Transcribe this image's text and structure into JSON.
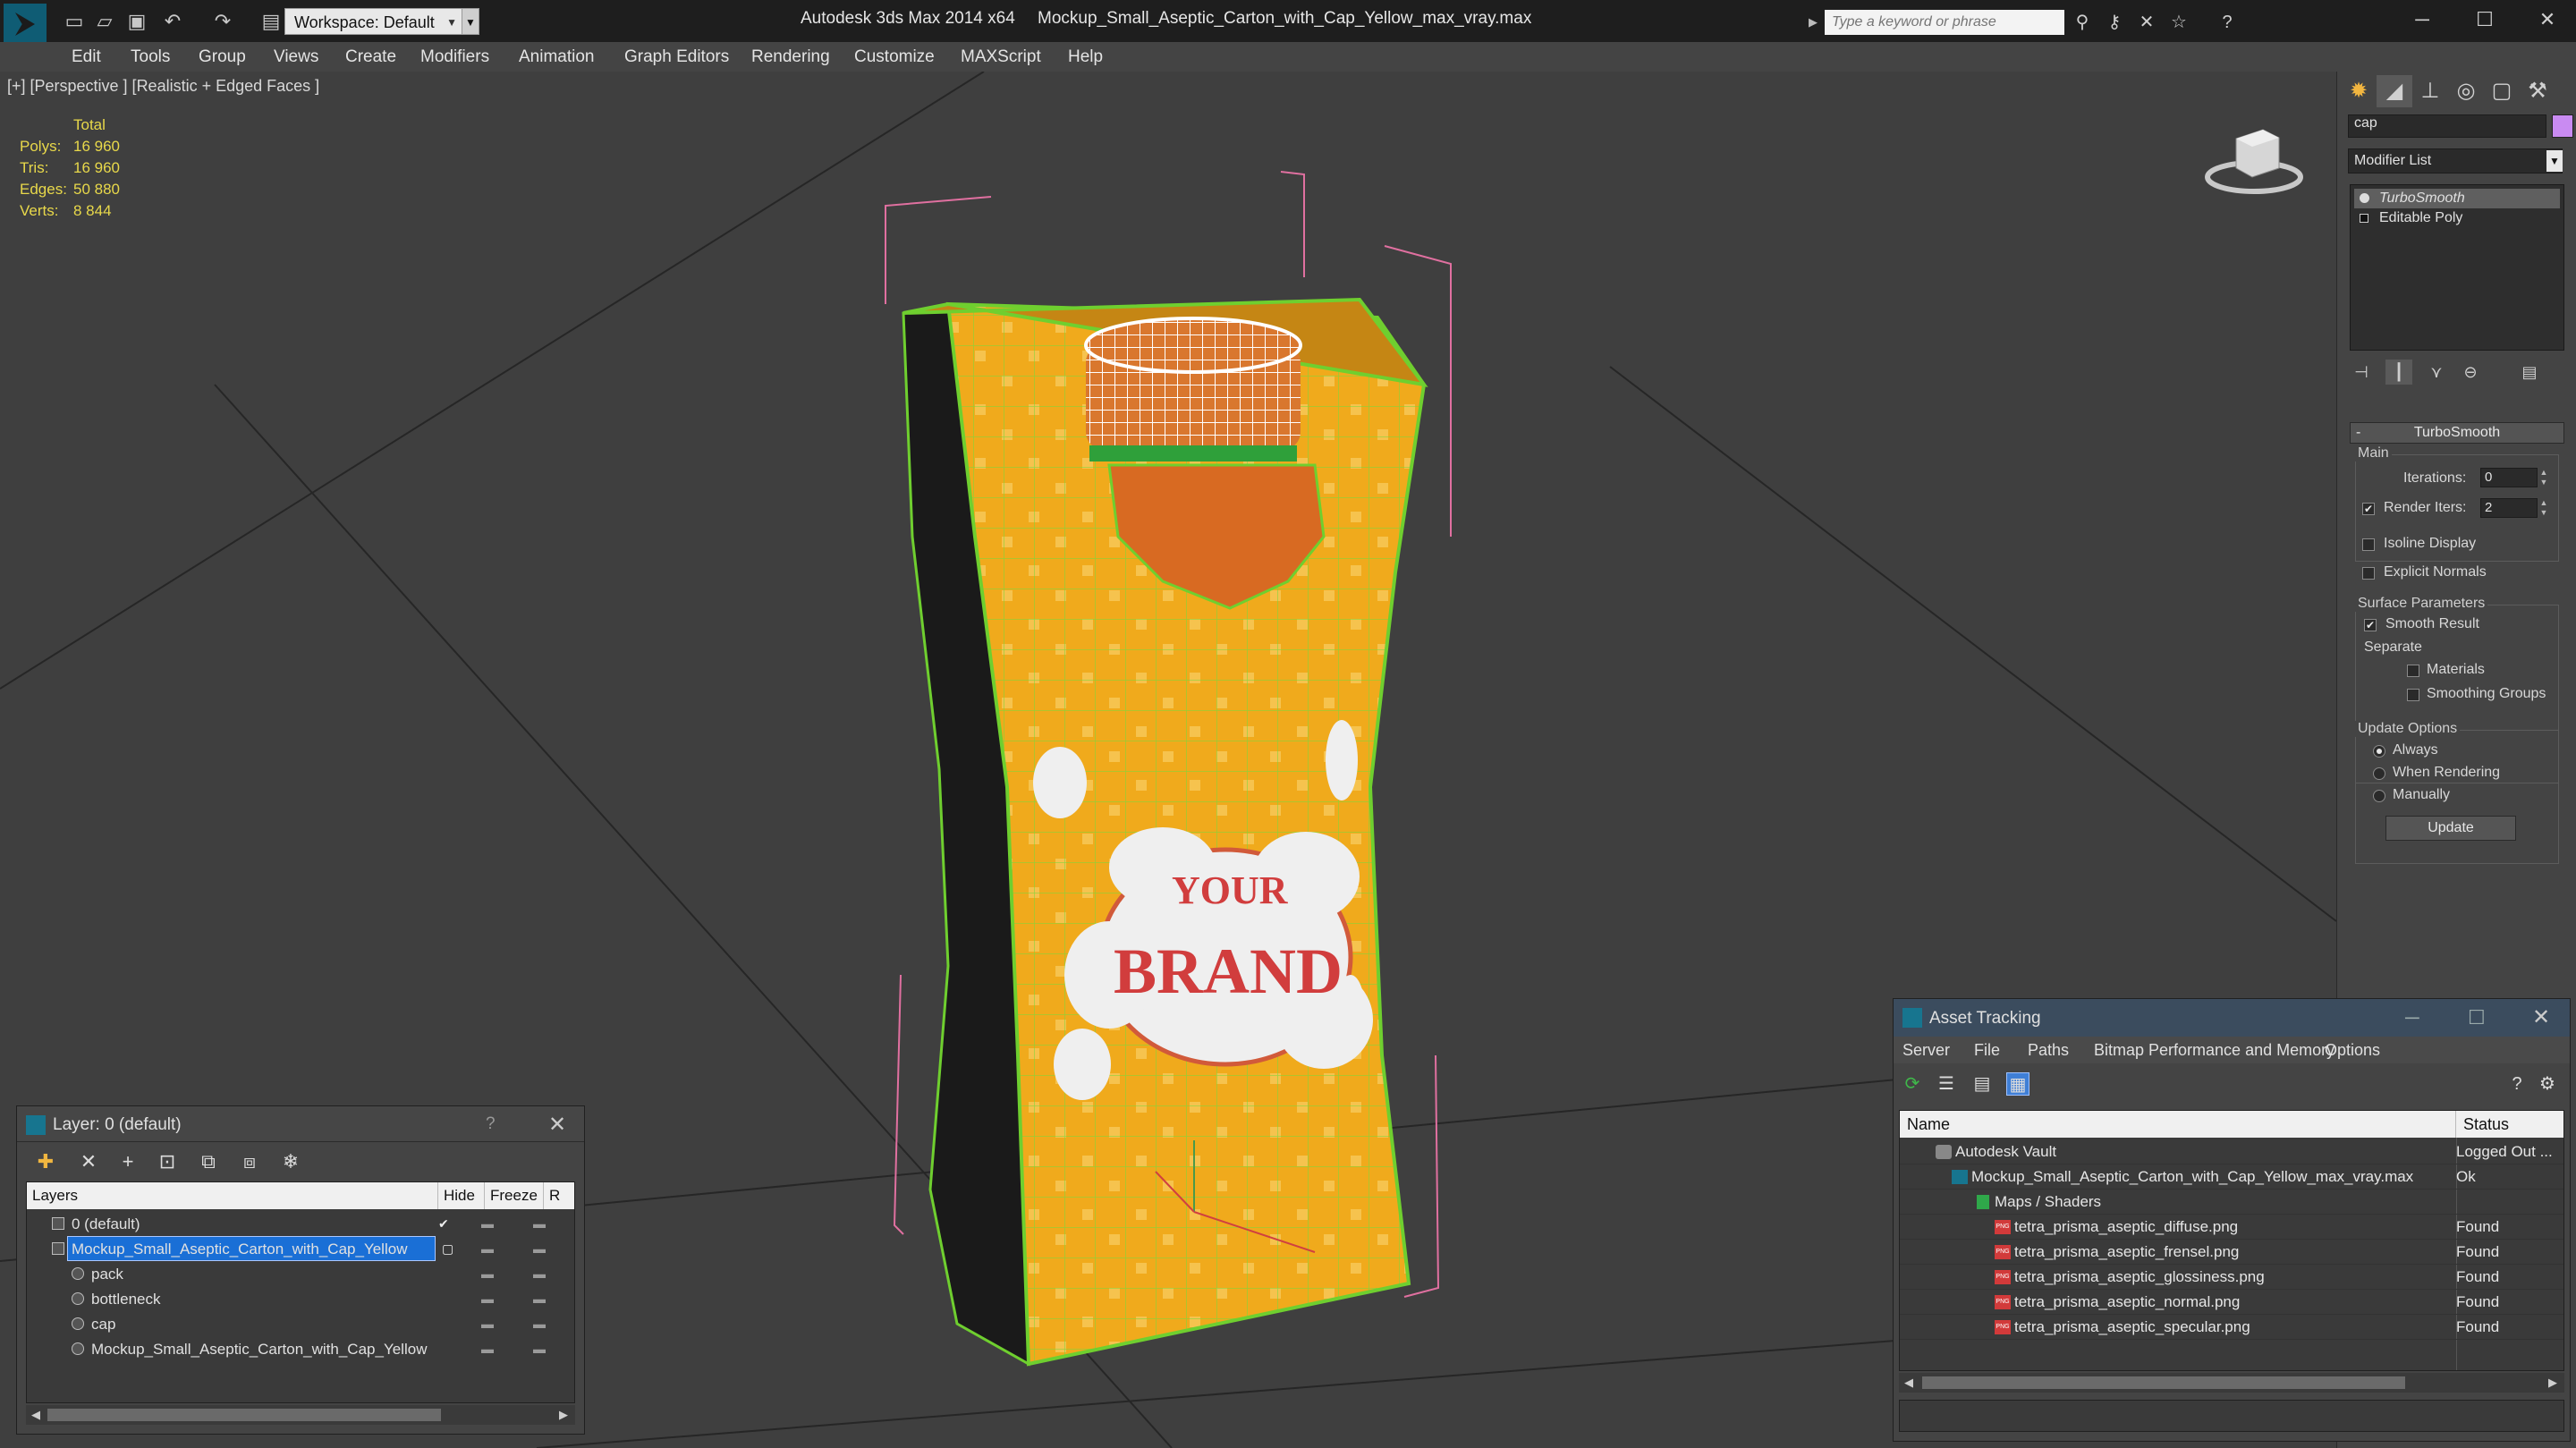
{
  "app": {
    "title": "Autodesk 3ds Max  2014 x64",
    "file": "Mockup_Small_Aseptic_Carton_with_Cap_Yellow_max_vray.max",
    "workspace": "Workspace: Default",
    "search_placeholder": "Type a keyword or phrase"
  },
  "menu": [
    "Edit",
    "Tools",
    "Group",
    "Views",
    "Create",
    "Modifiers",
    "Animation",
    "Graph Editors",
    "Rendering",
    "Customize",
    "MAXScript",
    "Help"
  ],
  "viewport": {
    "label": "[+] [Perspective ] [Realistic + Edged Faces ]",
    "stats": {
      "header": "Total",
      "rows": [
        {
          "key": "Polys:",
          "value": "16 960"
        },
        {
          "key": "Tris:",
          "value": "16 960"
        },
        {
          "key": "Edges:",
          "value": "50 880"
        },
        {
          "key": "Verts:",
          "value": "8 844"
        }
      ]
    },
    "label_text_top": "YOUR",
    "label_text_bottom": "BRAND"
  },
  "command_panel": {
    "object_name": "cap",
    "object_color": "#c98bf2",
    "modifier_list": "Modifier List",
    "stack": [
      "TurboSmooth",
      "Editable Poly"
    ],
    "rollout": "TurboSmooth",
    "main_group": "Main",
    "iterations_label": "Iterations:",
    "iterations": "0",
    "render_iters_label": "Render Iters:",
    "render_iters": "2",
    "isoline": "Isoline Display",
    "explicit_normals": "Explicit Normals",
    "surface_group": "Surface Parameters",
    "smooth_result": "Smooth Result",
    "separate": "Separate",
    "materials": "Materials",
    "smoothing_groups": "Smoothing Groups",
    "update_group": "Update Options",
    "always": "Always",
    "when_rendering": "When Rendering",
    "manually": "Manually",
    "update_button": "Update"
  },
  "layer_window": {
    "title": "Layer: 0 (default)",
    "help": "?",
    "columns": [
      "Layers",
      "Hide",
      "Freeze",
      "R"
    ],
    "rows": [
      {
        "name": "0 (default)",
        "indent": 1
      },
      {
        "name": "Mockup_Small_Aseptic_Carton_with_Cap_Yellow",
        "indent": 1
      },
      {
        "name": "pack",
        "indent": 2
      },
      {
        "name": "bottleneck",
        "indent": 2
      },
      {
        "name": "cap",
        "indent": 2
      },
      {
        "name": "Mockup_Small_Aseptic_Carton_with_Cap_Yellow",
        "indent": 2
      }
    ]
  },
  "asset_window": {
    "title": "Asset Tracking",
    "menu": [
      "Server",
      "File",
      "Paths",
      "Bitmap Performance and Memory",
      "Options"
    ],
    "columns": [
      "Name",
      "Status"
    ],
    "rows": [
      {
        "name": "Autodesk Vault",
        "status": "Logged Out ...",
        "icon": "vault",
        "indent": 1
      },
      {
        "name": "Mockup_Small_Aseptic_Carton_with_Cap_Yellow_max_vray.max",
        "status": "Ok",
        "icon": "max",
        "indent": 2
      },
      {
        "name": "Maps / Shaders",
        "status": "",
        "icon": "maps",
        "indent": 3
      },
      {
        "name": "tetra_prisma_aseptic_diffuse.png",
        "status": "Found",
        "icon": "png",
        "indent": 4
      },
      {
        "name": "tetra_prisma_aseptic_frensel.png",
        "status": "Found",
        "icon": "png",
        "indent": 4
      },
      {
        "name": "tetra_prisma_aseptic_glossiness.png",
        "status": "Found",
        "icon": "png",
        "indent": 4
      },
      {
        "name": "tetra_prisma_aseptic_normal.png",
        "status": "Found",
        "icon": "png",
        "indent": 4
      },
      {
        "name": "tetra_prisma_aseptic_specular.png",
        "status": "Found",
        "icon": "png",
        "indent": 4
      }
    ]
  }
}
